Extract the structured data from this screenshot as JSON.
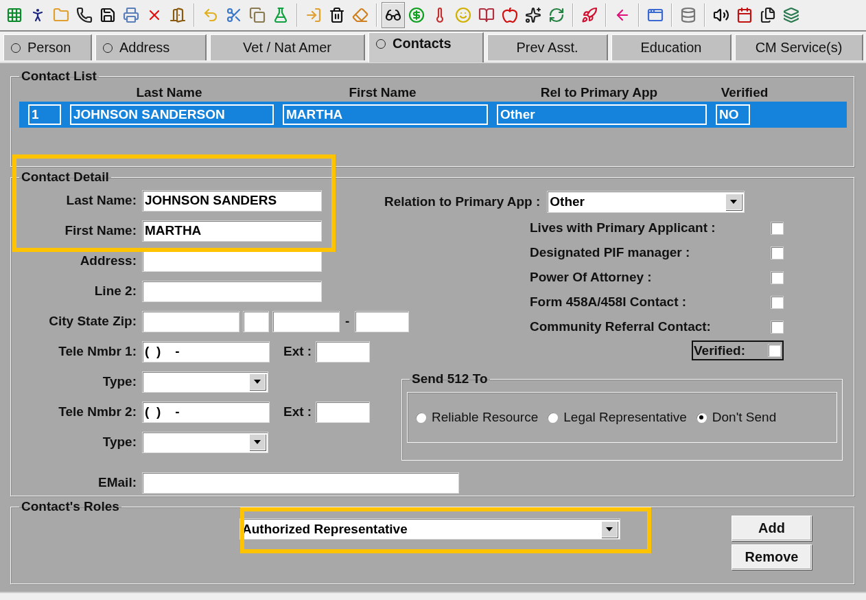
{
  "tabs": [
    {
      "label": "Person",
      "marked": true,
      "selected": false
    },
    {
      "label": "Address",
      "marked": true,
      "selected": false
    },
    {
      "label": "Vet / Nat Amer",
      "marked": false,
      "selected": false
    },
    {
      "label": "Contacts",
      "marked": true,
      "selected": true
    },
    {
      "label": "Prev Asst.",
      "marked": false,
      "selected": false
    },
    {
      "label": "Education",
      "marked": false,
      "selected": false
    },
    {
      "label": "CM Service(s)",
      "marked": false,
      "selected": false
    }
  ],
  "contact_list": {
    "title": "Contact List",
    "columns": [
      "Last Name",
      "First Name",
      "Rel to Primary App",
      "Verified"
    ],
    "rows": [
      {
        "number": "1",
        "last_name": "JOHNSON SANDERSON",
        "first_name": "MARTHA",
        "relation": "Other",
        "verified": "NO",
        "selected": true
      }
    ]
  },
  "contact_detail": {
    "title": "Contact Detail",
    "fields": [
      {
        "kind": "text",
        "label": "Last Name:",
        "value": "JOHNSON SANDERS"
      },
      {
        "kind": "text",
        "label": "First Name:",
        "value": "MARTHA"
      },
      {
        "kind": "text",
        "label": "Address:"
      },
      {
        "kind": "text",
        "label": "Line 2:"
      },
      {
        "kind": "city",
        "label": "City State Zip:",
        "separator": "-"
      },
      {
        "kind": "phone",
        "label": "Tele Nmbr 1:",
        "value": "(  )    -",
        "ext_label": "Ext :"
      },
      {
        "kind": "select",
        "label": "Type:"
      },
      {
        "kind": "phone",
        "label": "Tele Nmbr 2:",
        "value": "(  )    -",
        "ext_label": "Ext :"
      },
      {
        "kind": "select",
        "label": "Type:"
      }
    ],
    "email": {
      "label": "EMail:"
    },
    "relation": {
      "label": "Relation to Primary App :",
      "value": "Other"
    },
    "flags": [
      {
        "label": "Lives with Primary Applicant :",
        "checked": false
      },
      {
        "label": "Designated PIF manager :",
        "checked": false
      },
      {
        "label": "Power Of Attorney :",
        "checked": false
      },
      {
        "label": "Form 458A/458I Contact :",
        "checked": false
      },
      {
        "label": "Community Referral Contact:",
        "checked": false
      }
    ],
    "verified": {
      "label": "Verified:",
      "checked": false
    },
    "send_512": {
      "title": "Send 512 To",
      "options": [
        {
          "label": "Reliable Resource",
          "selected": false
        },
        {
          "label": "Legal Representative",
          "selected": false
        },
        {
          "label": "Don't Send",
          "selected": true
        }
      ]
    }
  },
  "roles": {
    "title": "Contact's Roles",
    "value": "Authorized Representative",
    "buttons": [
      "Add",
      "Remove"
    ]
  }
}
